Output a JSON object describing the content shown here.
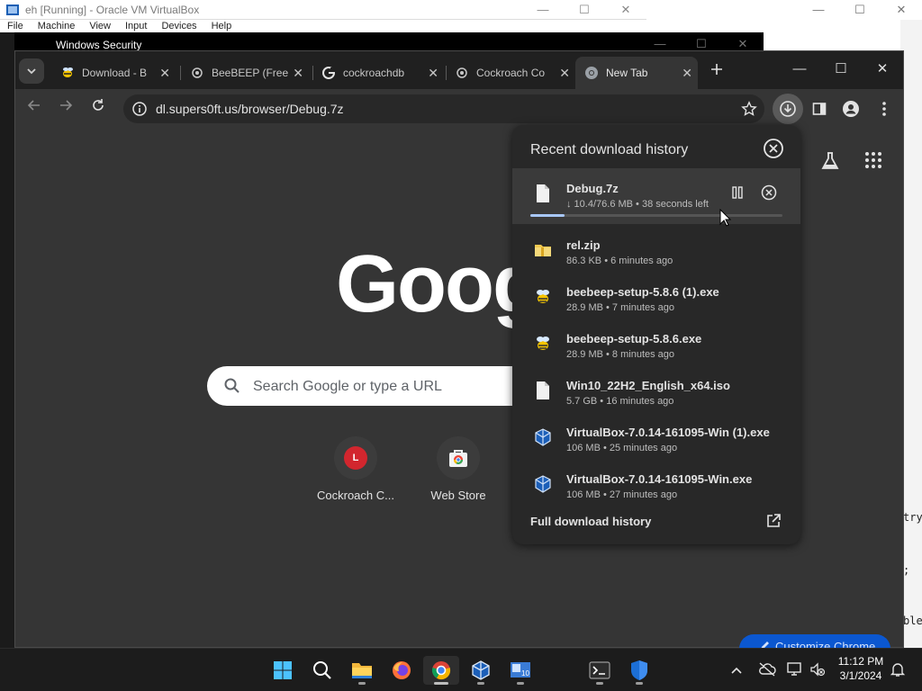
{
  "vbox": {
    "title": "eh [Running] - Oracle VM VirtualBox",
    "menu": [
      "File",
      "Machine",
      "View",
      "Input",
      "Devices",
      "Help"
    ],
    "controls": {
      "minimize": "—",
      "maximize": "☐",
      "close": "✕"
    }
  },
  "host_right_text": [
    "try",
    ";",
    "ble"
  ],
  "winsec": {
    "title": "Windows Security"
  },
  "chrome": {
    "tabs": [
      {
        "label": "Download - B",
        "favicon": "beebeep-icon"
      },
      {
        "label": "BeeBEEP (Free",
        "favicon": "chrome-link-icon"
      },
      {
        "label": "cockroachdb",
        "favicon": "google-icon"
      },
      {
        "label": "Cockroach Co",
        "favicon": "chrome-link-icon"
      },
      {
        "label": "New Tab",
        "favicon": "chrome-icon",
        "active": true
      }
    ],
    "url": "dl.supers0ft.us/browser/Debug.7z"
  },
  "ntp": {
    "logo": "Goog",
    "search_placeholder": "Search Google or type a URL",
    "shortcuts": [
      {
        "label": "Cockroach C...",
        "letter": "L"
      },
      {
        "label": "Web Store"
      }
    ],
    "customize_label": "Customize Chrome"
  },
  "downloads": {
    "title": "Recent download history",
    "active": {
      "name": "Debug.7z",
      "meta": "↓ 10.4/76.6 MB • 38 seconds left",
      "progress": 0.136
    },
    "items": [
      {
        "name": "rel.zip",
        "meta": "86.3 KB • 6 minutes ago",
        "icon": "folder-zip-icon"
      },
      {
        "name": "beebeep-setup-5.8.6 (1).exe",
        "meta": "28.9 MB • 7 minutes ago",
        "icon": "beebeep-icon"
      },
      {
        "name": "beebeep-setup-5.8.6.exe",
        "meta": "28.9 MB • 8 minutes ago",
        "icon": "beebeep-icon"
      },
      {
        "name": "Win10_22H2_English_x64.iso",
        "meta": "5.7 GB • 16 minutes ago",
        "icon": "file-icon"
      },
      {
        "name": "VirtualBox-7.0.14-161095-Win (1).exe",
        "meta": "106 MB • 25 minutes ago",
        "icon": "virtualbox-icon"
      },
      {
        "name": "VirtualBox-7.0.14-161095-Win.exe",
        "meta": "106 MB • 27 minutes ago",
        "icon": "virtualbox-icon"
      }
    ],
    "footer": "Full download history"
  },
  "taskbar": {
    "time": "11:12 PM",
    "date": "3/1/2024"
  }
}
